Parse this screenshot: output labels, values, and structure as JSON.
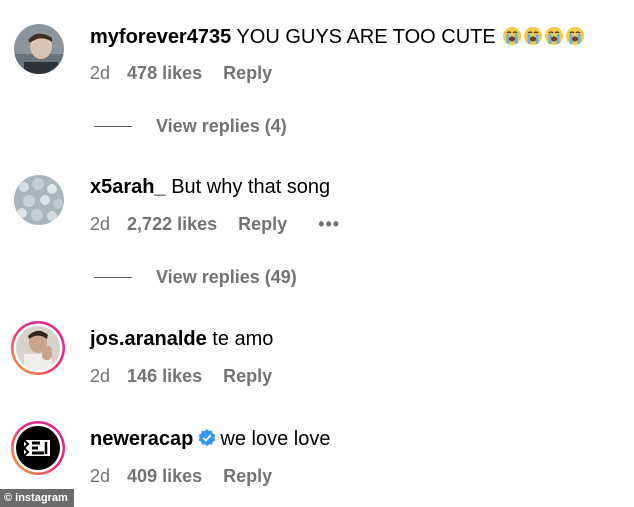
{
  "comments": [
    {
      "username": "myforever4735",
      "text": "YOU GUYS ARE TOO CUTE",
      "emoji": [
        "loudly-crying-face",
        "loudly-crying-face",
        "loudly-crying-face",
        "loudly-crying-face"
      ],
      "time": "2d",
      "likes": "478 likes",
      "reply": "Reply",
      "view_replies": "View replies (4)"
    },
    {
      "username": "x5arah_",
      "text": "But why that song",
      "time": "2d",
      "likes": "2,722 likes",
      "reply": "Reply",
      "more": "•••",
      "view_replies": "View replies (49)"
    },
    {
      "username": "jos.aranalde",
      "text": "te amo",
      "time": "2d",
      "likes": "146 likes",
      "reply": "Reply"
    },
    {
      "username": "neweracap",
      "verified": true,
      "text": "we love love",
      "time": "2d",
      "likes": "409 likes",
      "reply": "Reply"
    }
  ],
  "watermark": "© instagram",
  "colors": {
    "secondary_text": "#737373",
    "verified_blue": "#3897f0",
    "story_ring_start": "#f9a825",
    "story_ring_end": "#d6249f"
  }
}
